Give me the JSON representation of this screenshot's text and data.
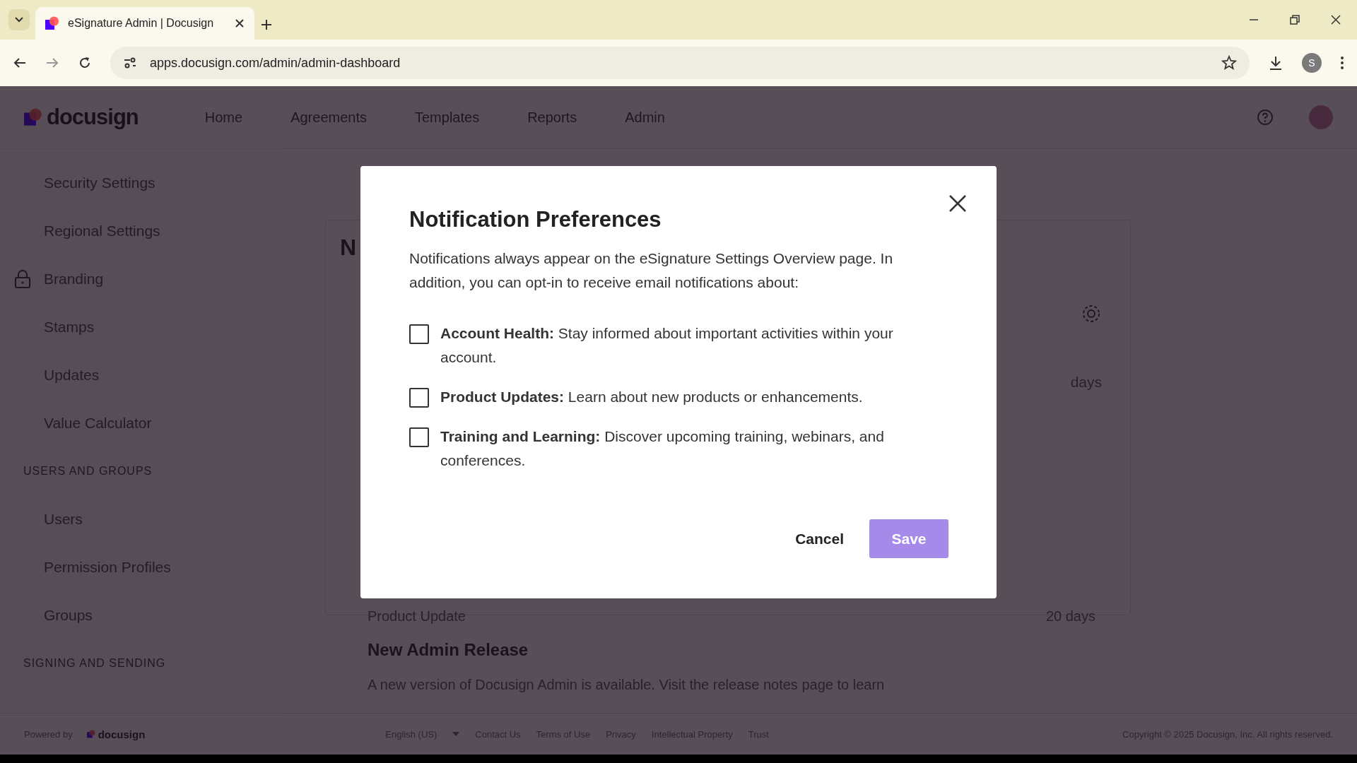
{
  "browser": {
    "tabs": [
      {
        "title": "eSignature Admin | Docusign",
        "selected": true
      }
    ],
    "url": "apps.docusign.com/admin/admin-dashboard",
    "profile_initial": "S"
  },
  "app": {
    "logo": "docusign",
    "nav": [
      {
        "label": "Home"
      },
      {
        "label": "Agreements"
      },
      {
        "label": "Templates"
      },
      {
        "label": "Reports"
      },
      {
        "label": "Admin"
      }
    ]
  },
  "sidebar": {
    "items": [
      {
        "kind": "link",
        "label": "Security Settings",
        "locked": false
      },
      {
        "kind": "link",
        "label": "Regional Settings",
        "locked": false
      },
      {
        "kind": "link",
        "label": "Branding",
        "locked": true
      },
      {
        "kind": "link",
        "label": "Stamps",
        "locked": false
      },
      {
        "kind": "link",
        "label": "Updates",
        "locked": false
      },
      {
        "kind": "link",
        "label": "Value Calculator",
        "locked": false
      },
      {
        "kind": "section",
        "label": "USERS AND GROUPS"
      },
      {
        "kind": "link",
        "label": "Users",
        "locked": false
      },
      {
        "kind": "link",
        "label": "Permission Profiles",
        "locked": false
      },
      {
        "kind": "link",
        "label": "Groups",
        "locked": false
      },
      {
        "kind": "section",
        "label": "SIGNING AND SENDING"
      }
    ]
  },
  "content": {
    "heading": "N",
    "side_text": "days",
    "update": {
      "type": "Product Update",
      "age": "20 days",
      "title": "New Admin Release",
      "text": "A new version of Docusign Admin is available. Visit the release notes page to learn"
    }
  },
  "modal": {
    "title": "Notification Preferences",
    "intro": "Notifications always appear on the eSignature Settings Overview page. In addition, you can opt-in to receive email notifications about:",
    "options": [
      {
        "text": "**Account Health:** Stay informed about important activities within your account.",
        "checked": false
      },
      {
        "text": "**Product Updates:** Learn about new products or enhancements.",
        "checked": false
      },
      {
        "text": "**Training and Learning:** Discover upcoming training, webinars, and conferences.",
        "checked": false
      }
    ],
    "cancel": "Cancel",
    "save": {
      "label": "Save",
      "disabled": true
    }
  },
  "footer": {
    "powered_by": "Powered by",
    "logo": "docusign",
    "language": "English (US)",
    "links": [
      "Contact Us",
      "Terms of Use",
      "Privacy",
      "Intellectual Property",
      "Trust"
    ],
    "copyright": "Copyright © 2025 Docusign, Inc. All rights reserved."
  }
}
